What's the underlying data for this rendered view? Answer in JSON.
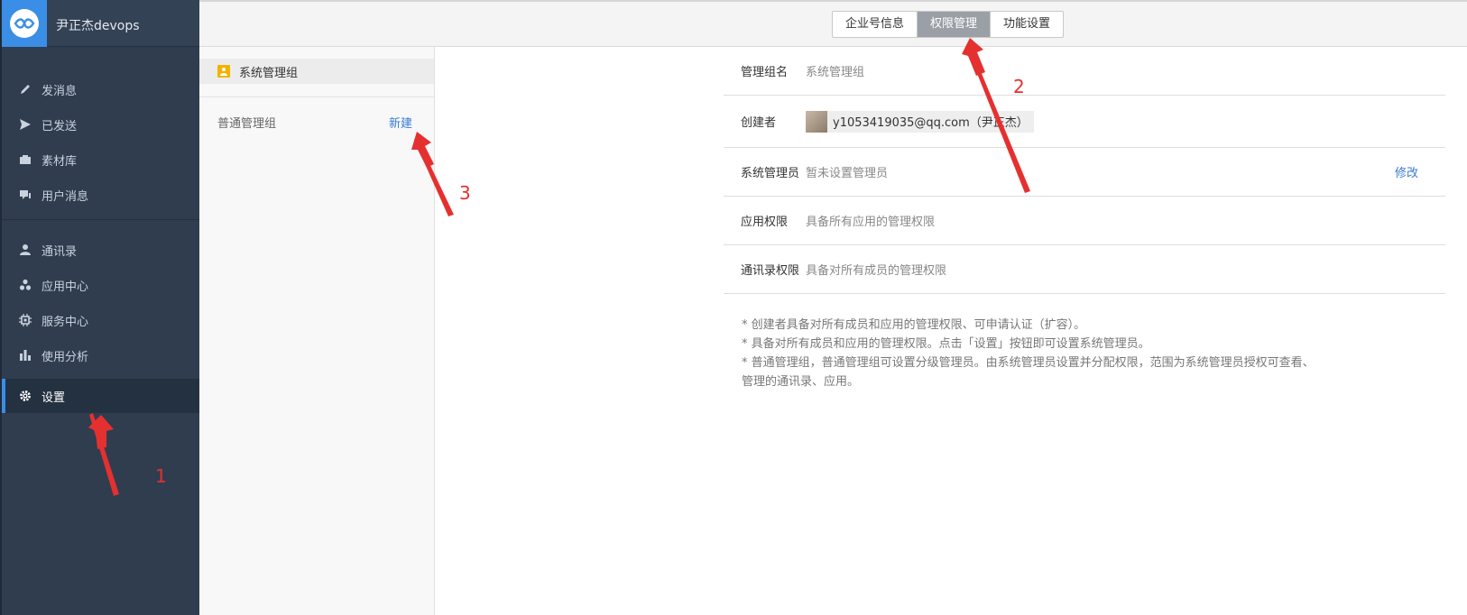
{
  "sidebar": {
    "brand": "尹正杰devops",
    "items": [
      {
        "label": "发消息",
        "icon": "pencil-icon"
      },
      {
        "label": "已发送",
        "icon": "send-icon"
      },
      {
        "label": "素材库",
        "icon": "briefcase-icon"
      },
      {
        "label": "用户消息",
        "icon": "chat-icon"
      },
      {
        "label": "通讯录",
        "icon": "person-icon"
      },
      {
        "label": "应用中心",
        "icon": "apps-icon"
      },
      {
        "label": "服务中心",
        "icon": "chip-icon"
      },
      {
        "label": "使用分析",
        "icon": "bar-chart-icon"
      },
      {
        "label": "设置",
        "icon": "gear-icon",
        "active": true
      }
    ]
  },
  "topbar": {
    "tabs": [
      {
        "label": "企业号信息"
      },
      {
        "label": "权限管理",
        "active": true
      },
      {
        "label": "功能设置"
      }
    ]
  },
  "groups": {
    "system_group": "系统管理组",
    "normal_group": "普通管理组",
    "new_label": "新建"
  },
  "detail": {
    "rows": [
      {
        "label": "管理组名",
        "value": "系统管理组"
      },
      {
        "label": "创建者",
        "value": "y1053419035@qq.com（尹正杰）"
      },
      {
        "label": "系统管理员",
        "value": "暂未设置管理员",
        "action": "修改"
      },
      {
        "label": "应用权限",
        "value": "具备所有应用的管理权限"
      },
      {
        "label": "通讯录权限",
        "value": "具备对所有成员的管理权限"
      }
    ]
  },
  "notes": [
    "* 创建者具备对所有成员和应用的管理权限、可申请认证（扩容）。",
    "* 具备对所有成员和应用的管理权限。点击「设置」按钮即可设置系统管理员。",
    "* 普通管理组，普通管理组可设置分级管理员。由系统管理员设置并分配权限，范围为系统管理员授权可查看、管理的通讯录、应用。"
  ],
  "annotations": [
    "1",
    "2",
    "3"
  ],
  "colors": {
    "accent": "#3a8ee6",
    "sidebar": "#2f3d4f",
    "arrow": "#e53030",
    "link": "#3a7bd5"
  }
}
